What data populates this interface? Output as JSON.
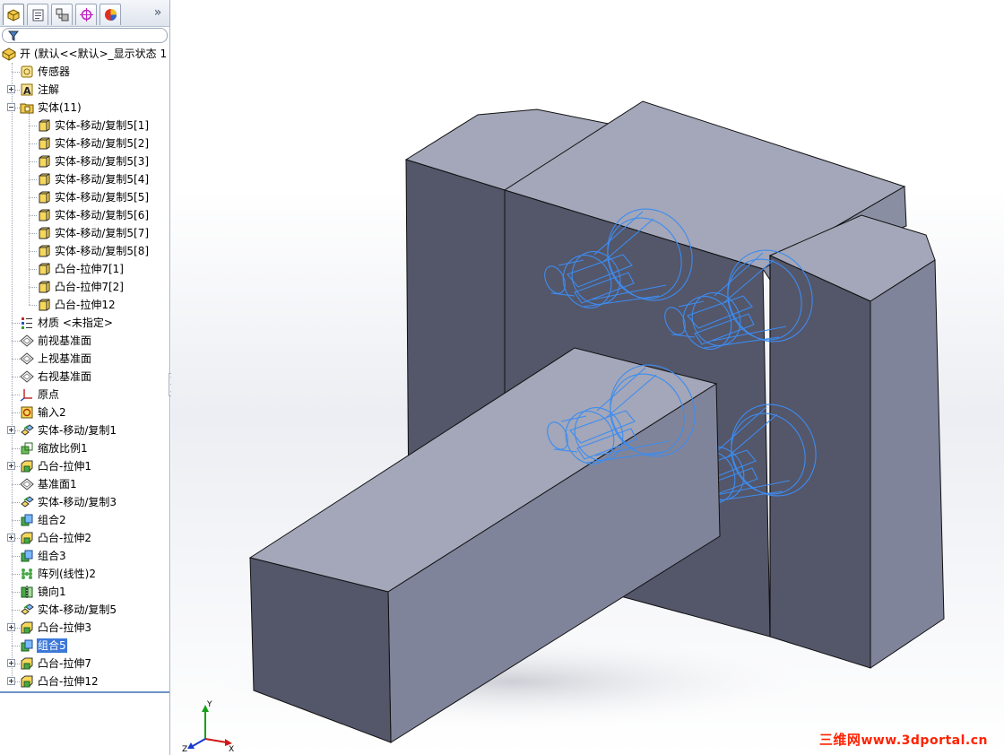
{
  "feature_manager": {
    "tabs": [
      {
        "icon": "feature-tree-icon",
        "active": true
      },
      {
        "icon": "property-manager-icon",
        "active": false
      },
      {
        "icon": "configuration-manager-icon",
        "active": false
      },
      {
        "icon": "dimxpert-icon",
        "active": false
      },
      {
        "icon": "display-manager-icon",
        "active": false
      }
    ],
    "expand_glyph": "»",
    "filter_icon": "filter-icon",
    "tree": [
      {
        "label": "开 (默认<<默认>_显示状态 1",
        "icon": "part-icon",
        "level": 0,
        "expander": "none"
      },
      {
        "label": "传感器",
        "icon": "sensor-icon",
        "level": 1,
        "expander": "none"
      },
      {
        "label": "注解",
        "icon": "annotation-icon",
        "level": 1,
        "expander": "plus"
      },
      {
        "label": "实体(11)",
        "icon": "solid-bodies-folder-icon",
        "level": 1,
        "expander": "minus"
      },
      {
        "label": "实体-移动/复制5[1]",
        "icon": "solid-body-icon",
        "level": 2,
        "expander": "none"
      },
      {
        "label": "实体-移动/复制5[2]",
        "icon": "solid-body-icon",
        "level": 2,
        "expander": "none"
      },
      {
        "label": "实体-移动/复制5[3]",
        "icon": "solid-body-icon",
        "level": 2,
        "expander": "none"
      },
      {
        "label": "实体-移动/复制5[4]",
        "icon": "solid-body-icon",
        "level": 2,
        "expander": "none"
      },
      {
        "label": "实体-移动/复制5[5]",
        "icon": "solid-body-icon",
        "level": 2,
        "expander": "none"
      },
      {
        "label": "实体-移动/复制5[6]",
        "icon": "solid-body-icon",
        "level": 2,
        "expander": "none"
      },
      {
        "label": "实体-移动/复制5[7]",
        "icon": "solid-body-icon",
        "level": 2,
        "expander": "none"
      },
      {
        "label": "实体-移动/复制5[8]",
        "icon": "solid-body-icon",
        "level": 2,
        "expander": "none"
      },
      {
        "label": "凸台-拉伸7[1]",
        "icon": "solid-body-icon",
        "level": 2,
        "expander": "none"
      },
      {
        "label": "凸台-拉伸7[2]",
        "icon": "solid-body-icon",
        "level": 2,
        "expander": "none"
      },
      {
        "label": "凸台-拉伸12",
        "icon": "solid-body-icon",
        "level": 2,
        "expander": "none"
      },
      {
        "label": "材质 <未指定>",
        "icon": "material-icon",
        "level": 1,
        "expander": "none"
      },
      {
        "label": "前视基准面",
        "icon": "plane-icon",
        "level": 1,
        "expander": "none"
      },
      {
        "label": "上视基准面",
        "icon": "plane-icon",
        "level": 1,
        "expander": "none"
      },
      {
        "label": "右视基准面",
        "icon": "plane-icon",
        "level": 1,
        "expander": "none"
      },
      {
        "label": "原点",
        "icon": "origin-icon",
        "level": 1,
        "expander": "none"
      },
      {
        "label": "输入2",
        "icon": "imported-body-icon",
        "level": 1,
        "expander": "none"
      },
      {
        "label": "实体-移动/复制1",
        "icon": "move-copy-icon",
        "level": 1,
        "expander": "plus"
      },
      {
        "label": "缩放比例1",
        "icon": "scale-icon",
        "level": 1,
        "expander": "none"
      },
      {
        "label": "凸台-拉伸1",
        "icon": "extrude-boss-icon",
        "level": 1,
        "expander": "plus"
      },
      {
        "label": "基准面1",
        "icon": "plane-icon",
        "level": 1,
        "expander": "none"
      },
      {
        "label": "实体-移动/复制3",
        "icon": "move-copy-icon",
        "level": 1,
        "expander": "none"
      },
      {
        "label": "组合2",
        "icon": "combine-icon",
        "level": 1,
        "expander": "none"
      },
      {
        "label": "凸台-拉伸2",
        "icon": "extrude-boss-icon",
        "level": 1,
        "expander": "plus"
      },
      {
        "label": "组合3",
        "icon": "combine-icon",
        "level": 1,
        "expander": "none"
      },
      {
        "label": "阵列(线性)2",
        "icon": "linear-pattern-icon",
        "level": 1,
        "expander": "none"
      },
      {
        "label": "镜向1",
        "icon": "mirror-icon",
        "level": 1,
        "expander": "none"
      },
      {
        "label": "实体-移动/复制5",
        "icon": "move-copy-icon",
        "level": 1,
        "expander": "none"
      },
      {
        "label": "凸台-拉伸3",
        "icon": "extrude-boss-icon",
        "level": 1,
        "expander": "plus"
      },
      {
        "label": "组合5",
        "icon": "combine-icon",
        "level": 1,
        "expander": "none",
        "selected": true
      },
      {
        "label": "凸台-拉伸7",
        "icon": "extrude-boss-icon",
        "level": 1,
        "expander": "plus"
      },
      {
        "label": "凸台-拉伸12",
        "icon": "extrude-boss-icon",
        "level": 1,
        "expander": "plus"
      }
    ]
  },
  "triad": {
    "x_label": "X",
    "y_label": "Y",
    "z_label": "Z"
  },
  "watermark": {
    "text_cn": "三维网",
    "text_url": "www.3dportal.cn"
  },
  "colors": {
    "model_top": "#a3a7b9",
    "model_front": "#80849a",
    "model_side": "#54566a",
    "wireframe": "#3c8cf0",
    "selection": "#3c78d8",
    "watermark": "#ff2200"
  }
}
